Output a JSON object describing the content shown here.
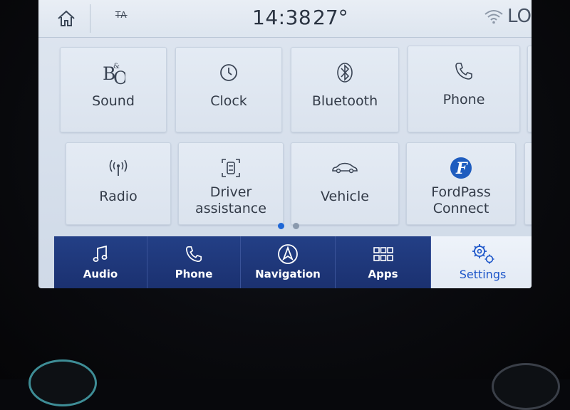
{
  "status_bar": {
    "ta_label": "TA",
    "time": "14:38",
    "temperature": "27°",
    "signal_label": "LO"
  },
  "tiles": [
    {
      "label": "Sound",
      "icon": "bang-olufsen-logo-icon"
    },
    {
      "label": "Clock",
      "icon": "clock-icon"
    },
    {
      "label": "Bluetooth",
      "icon": "bluetooth-icon"
    },
    {
      "label": "Phone",
      "icon": "phone-icon"
    },
    {
      "label": "Radio",
      "icon": "radio-antenna-icon"
    },
    {
      "label": "Driver assistance",
      "label_line1": "Driver",
      "label_line2": "assistance",
      "icon": "driver-assist-icon"
    },
    {
      "label": "Vehicle",
      "icon": "car-icon"
    },
    {
      "label": "FordPass Connect",
      "label_line1": "FordPass",
      "label_line2": "Connect",
      "icon": "fordpass-logo-icon"
    }
  ],
  "pager": {
    "pages": 2,
    "current": 1
  },
  "nav": [
    {
      "label": "Audio",
      "icon": "music-note-icon"
    },
    {
      "label": "Phone",
      "icon": "phone-icon"
    },
    {
      "label": "Navigation",
      "icon": "navigation-arrow-icon"
    },
    {
      "label": "Apps",
      "icon": "apps-grid-icon"
    },
    {
      "label": "Settings",
      "icon": "settings-gears-icon",
      "active": true
    }
  ],
  "colors": {
    "nav_bar": "#233f86",
    "accent": "#1c55c9",
    "screen_bg": "#d7e0ec"
  }
}
